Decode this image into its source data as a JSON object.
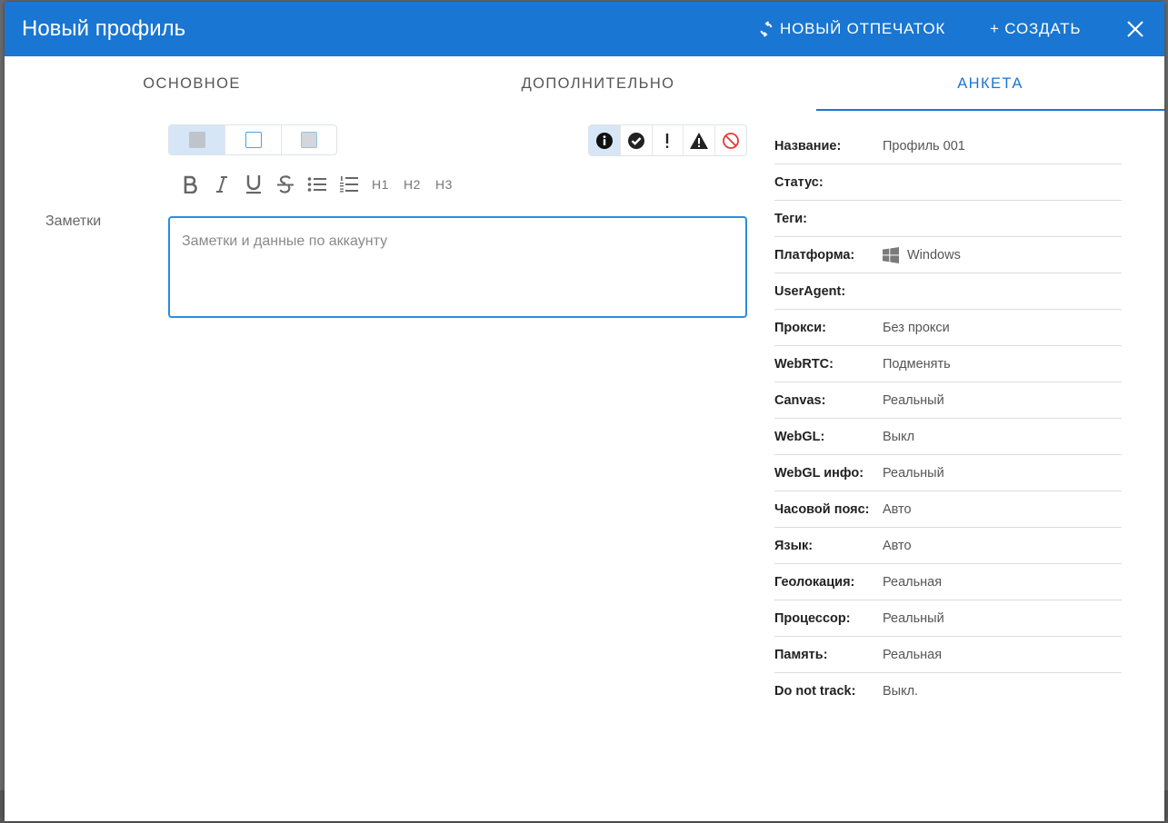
{
  "dialog": {
    "title": "Новый профиль",
    "new_fingerprint_label": "НОВЫЙ ОТПЕЧАТОК",
    "create_label": "+ СОЗДАТЬ",
    "accent_color": "#1976d2"
  },
  "tabs": [
    {
      "label": "ОСНОВНОЕ",
      "active": false
    },
    {
      "label": "ДОПОЛНИТЕЛЬНО",
      "active": false
    },
    {
      "label": "АНКЕТА",
      "active": true
    }
  ],
  "color_options": [
    {
      "name": "gray",
      "color": "#bfc4cb",
      "selected": true
    },
    {
      "name": "white",
      "color": "#ffffff",
      "selected": false
    },
    {
      "name": "light-gray",
      "color": "#d3d6da",
      "selected": false
    }
  ],
  "status_options": [
    {
      "icon": "info-icon",
      "selected": true
    },
    {
      "icon": "check-icon",
      "selected": false
    },
    {
      "icon": "exclamation-icon",
      "selected": false
    },
    {
      "icon": "warning-icon",
      "selected": false
    },
    {
      "icon": "ban-icon",
      "selected": false
    }
  ],
  "format_toolbar": {
    "bold": "bold-icon",
    "italic": "italic-icon",
    "underline": "underline-icon",
    "strike": "strikethrough-icon",
    "bullet_list": "bullet-list-icon",
    "numbered_list": "numbered-list-icon",
    "h1": "H1",
    "h2": "H2",
    "h3": "H3"
  },
  "notes": {
    "label": "Заметки",
    "placeholder": "Заметки и данные по аккаунту",
    "value": ""
  },
  "summary": [
    {
      "key": "Название:",
      "value": "Профиль 001"
    },
    {
      "key": "Статус:",
      "value": ""
    },
    {
      "key": "Теги:",
      "value": ""
    },
    {
      "key": "Платформа:",
      "value": "Windows",
      "icon": "windows-icon"
    },
    {
      "key": "UserAgent:",
      "value": ""
    },
    {
      "key": "Прокси:",
      "value": "Без прокси"
    },
    {
      "key": "WebRTC:",
      "value": "Подменять"
    },
    {
      "key": "Canvas:",
      "value": "Реальный"
    },
    {
      "key": "WebGL:",
      "value": "Выкл"
    },
    {
      "key": "WebGL инфо:",
      "value": "Реальный"
    },
    {
      "key": "Часовой пояс:",
      "value": "Авто"
    },
    {
      "key": "Язык:",
      "value": "Авто"
    },
    {
      "key": "Геолокация:",
      "value": "Реальная"
    },
    {
      "key": "Процессор:",
      "value": "Реальный"
    },
    {
      "key": "Память:",
      "value": "Реальная"
    },
    {
      "key": "Do not track:",
      "value": "Выкл."
    }
  ]
}
